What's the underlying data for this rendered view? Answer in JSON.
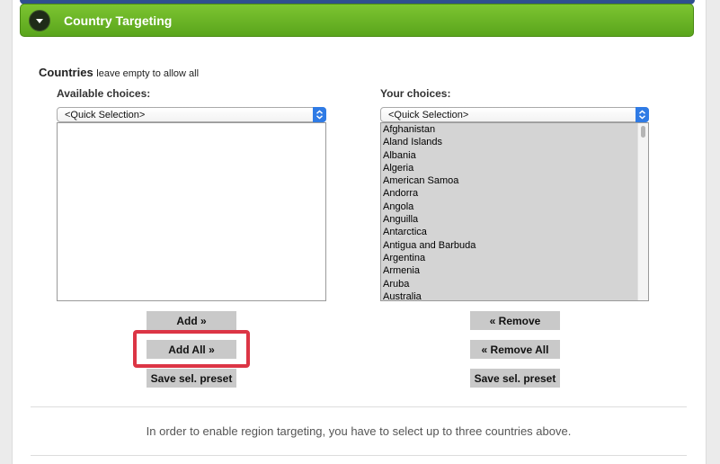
{
  "section": {
    "title": "Country Targeting",
    "toggle_icon": "chevron-down-icon"
  },
  "countries": {
    "label": "Countries",
    "hint": "leave empty to allow all"
  },
  "available": {
    "label": "Available choices:",
    "quick_selection": "<Quick Selection>",
    "items": []
  },
  "chosen": {
    "label": "Your choices:",
    "quick_selection": "<Quick Selection>",
    "items": [
      "Afghanistan",
      "Aland Islands",
      "Albania",
      "Algeria",
      "American Samoa",
      "Andorra",
      "Angola",
      "Anguilla",
      "Antarctica",
      "Antigua and Barbuda",
      "Argentina",
      "Armenia",
      "Aruba",
      "Australia"
    ]
  },
  "buttons": {
    "add": "Add »",
    "add_all": "Add All »",
    "save_preset_left": "Save sel. preset",
    "remove": "« Remove",
    "remove_all": "« Remove All",
    "save_preset_right": "Save sel. preset"
  },
  "info": {
    "message": "In order to enable region targeting, you have to select up to three countries above."
  },
  "colors": {
    "header_green": "#6bb526",
    "highlight_red": "#dc3545",
    "select_accent": "#2f7be5"
  }
}
